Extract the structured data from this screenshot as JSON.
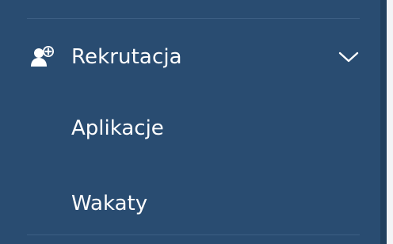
{
  "sidebar": {
    "section": {
      "label": "Rekrutacja",
      "icon": "add-user-icon",
      "expanded": true,
      "items": [
        {
          "label": "Aplikacje"
        },
        {
          "label": "Wakaty"
        }
      ]
    },
    "colors": {
      "background": "#294c71",
      "text": "#ffffff",
      "divider": "#3d5f84"
    }
  }
}
